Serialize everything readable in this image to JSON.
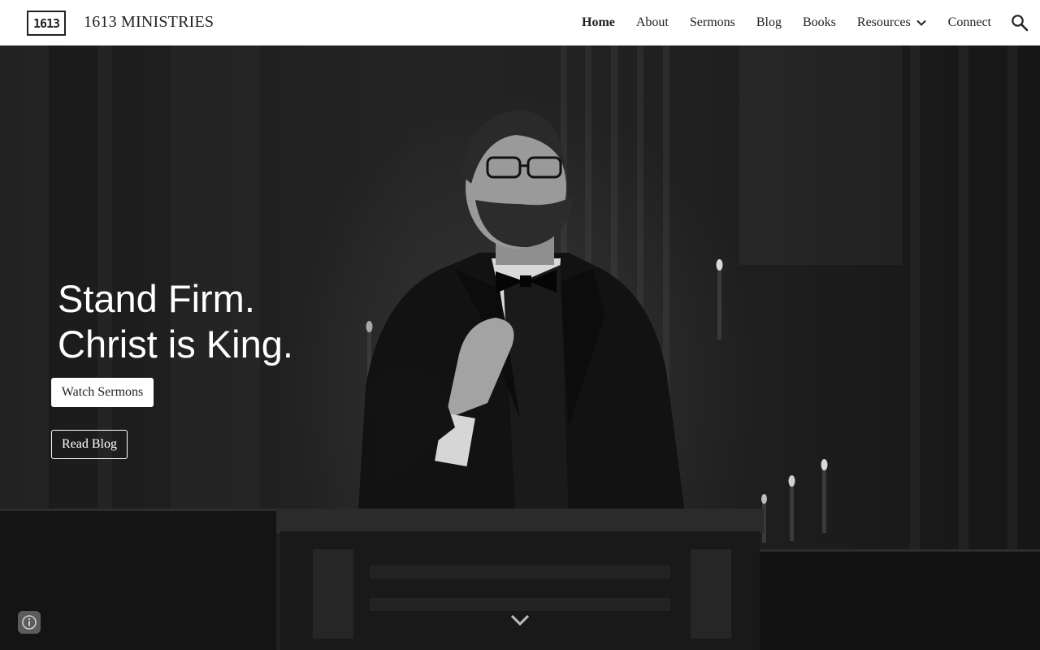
{
  "site": {
    "logo_text": "1613",
    "title": "1613 MINISTRIES"
  },
  "nav": {
    "items": [
      {
        "label": "Home",
        "active": true
      },
      {
        "label": "About",
        "active": false
      },
      {
        "label": "Sermons",
        "active": false
      },
      {
        "label": "Blog",
        "active": false
      },
      {
        "label": "Books",
        "active": false
      },
      {
        "label": "Resources",
        "active": false,
        "has_dropdown": true
      },
      {
        "label": "Connect",
        "active": false
      }
    ],
    "search_icon": "search-icon"
  },
  "hero": {
    "line1": "Stand Firm.",
    "line2": "Christ is King.",
    "watch_label": "Watch Sermons",
    "read_label": "Read Blog",
    "scroll_icon": "chevron-down-icon",
    "info_icon": "info-icon"
  },
  "colors": {
    "header_bg": "#ffffff",
    "hero_text": "#ffffff",
    "nav_text": "#222222"
  }
}
